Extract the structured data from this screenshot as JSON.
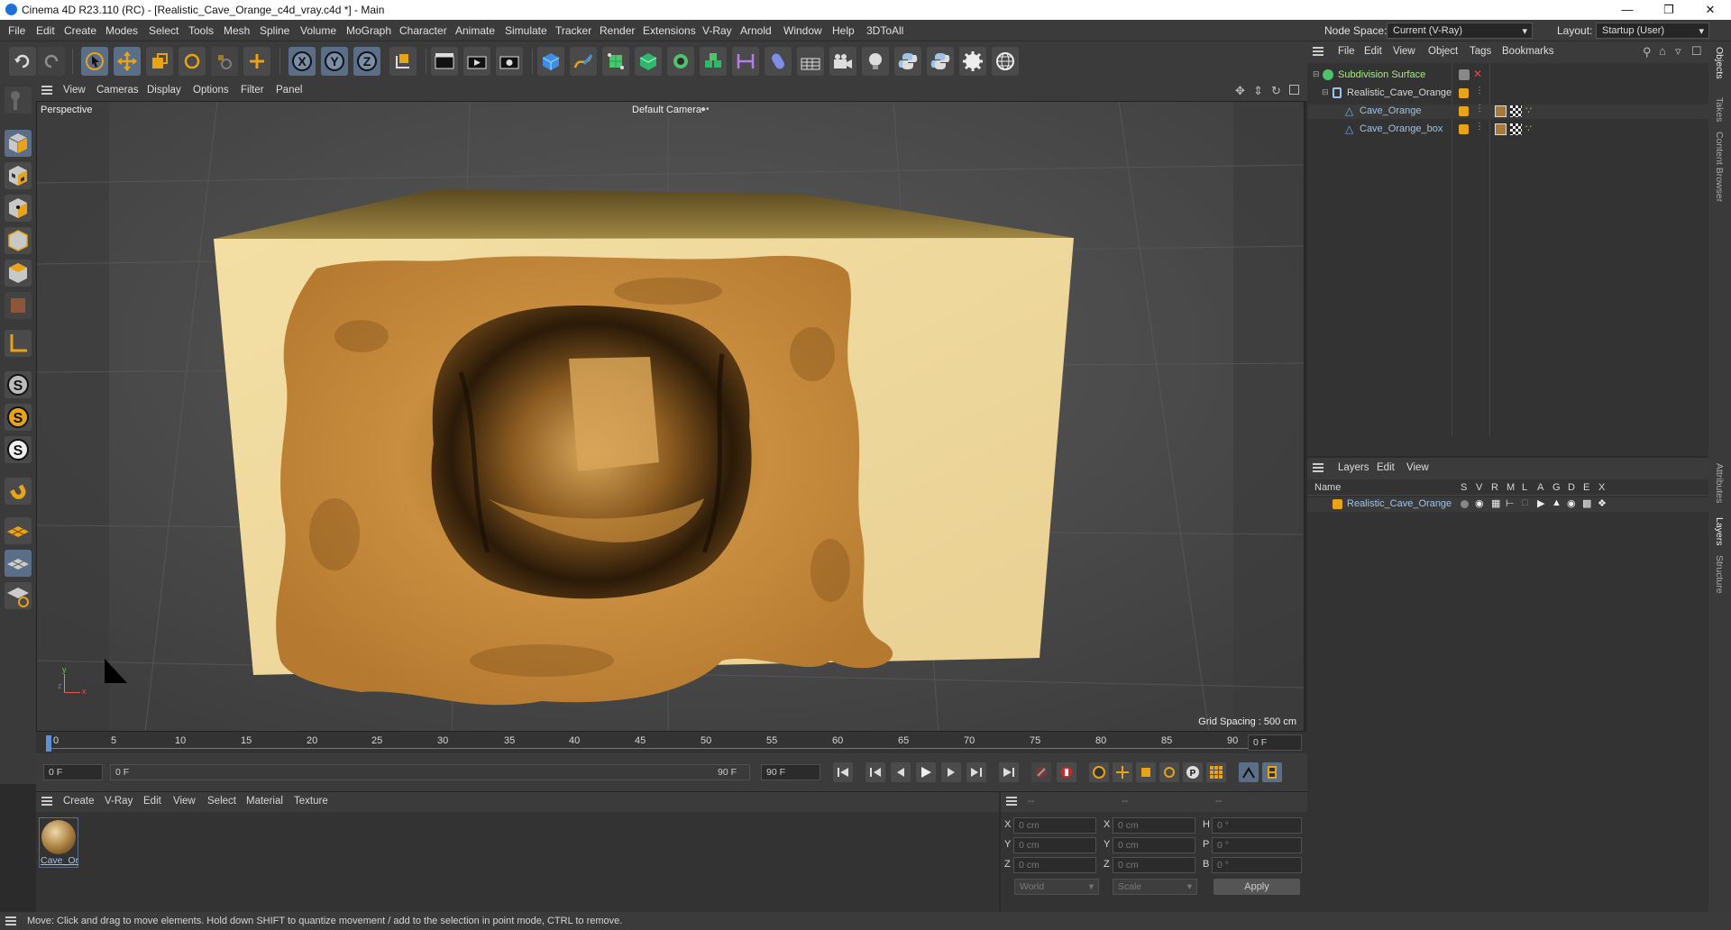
{
  "window": {
    "title": "Cinema 4D R23.110 (RC) - [Realistic_Cave_Orange_c4d_vray.c4d *] - Main",
    "minimize": "—",
    "maximize": "❐",
    "close": "✕"
  },
  "menu": [
    "File",
    "Edit",
    "Create",
    "Modes",
    "Select",
    "Tools",
    "Mesh",
    "Spline",
    "Volume",
    "MoGraph",
    "Character",
    "Animate",
    "Simulate",
    "Tracker",
    "Render",
    "Extensions",
    "V-Ray",
    "Arnold",
    "Window",
    "Help",
    "3DToAll"
  ],
  "nodespace": {
    "label": "Node Space:",
    "value": "Current (V-Ray)"
  },
  "layout": {
    "label": "Layout:",
    "value": "Startup (User)"
  },
  "viewport_menu": [
    "View",
    "Cameras",
    "Display",
    "Options",
    "Filter",
    "Panel"
  ],
  "viewport": {
    "name": "Perspective",
    "camera": "Default Camera",
    "grid_spacing": "Grid Spacing : 500 cm",
    "axis_x": "x",
    "axis_y": "y",
    "axis_z": "z"
  },
  "timeline": {
    "ticks": [
      "0",
      "5",
      "10",
      "15",
      "20",
      "25",
      "30",
      "35",
      "40",
      "45",
      "50",
      "55",
      "60",
      "65",
      "70",
      "75",
      "80",
      "85",
      "90"
    ],
    "frame_right": "0 F"
  },
  "transport": {
    "start": "0 F",
    "current": "0 F",
    "end_inner": "90 F",
    "end": "90 F"
  },
  "objects_menu": [
    "File",
    "Edit",
    "View",
    "Object",
    "Tags",
    "Bookmarks"
  ],
  "objects": [
    {
      "name": "Subdivision Surface"
    },
    {
      "name": "Realistic_Cave_Orange"
    },
    {
      "name": "Cave_Orange"
    },
    {
      "name": "Cave_Orange_box"
    }
  ],
  "layers_menu": [
    "Layers",
    "Edit",
    "View"
  ],
  "layers_header": {
    "name": "Name",
    "cols": [
      "S",
      "V",
      "R",
      "M",
      "L",
      "A",
      "G",
      "D",
      "E",
      "X"
    ]
  },
  "layers": [
    {
      "name": "Realistic_Cave_Orange"
    }
  ],
  "material_menu": [
    "Create",
    "V-Ray",
    "Edit",
    "View",
    "Select",
    "Material",
    "Texture"
  ],
  "material": {
    "name": "Cave_Or"
  },
  "attributes": {
    "header": [
      "--",
      "--",
      "--"
    ],
    "rows": [
      {
        "a": "X",
        "av": "0 cm",
        "b": "X",
        "bv": "0 cm",
        "c": "H",
        "cv": "0 °"
      },
      {
        "a": "Y",
        "av": "0 cm",
        "b": "Y",
        "bv": "0 cm",
        "c": "P",
        "cv": "0 °"
      },
      {
        "a": "Z",
        "av": "0 cm",
        "b": "Z",
        "bv": "0 cm",
        "c": "B",
        "cv": "0 °"
      }
    ],
    "coord": "World",
    "mode": "Scale",
    "apply": "Apply"
  },
  "right_tabs": [
    "Objects",
    "Takes",
    "Content Browser",
    "Attributes",
    "Layers",
    "Structure"
  ],
  "status": "Move: Click and drag to move elements. Hold down SHIFT to quantize movement / add to the selection in point mode, CTRL to remove.",
  "colors": {
    "accent": "#e8a317",
    "selected": "#5a6e88",
    "bg": "#333333"
  }
}
